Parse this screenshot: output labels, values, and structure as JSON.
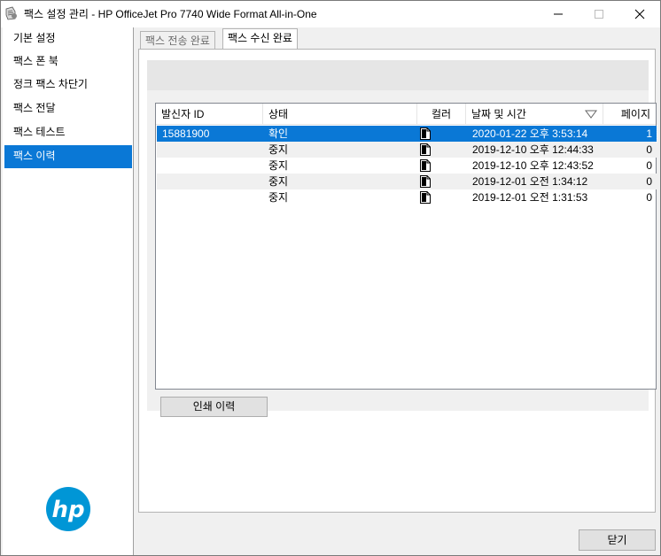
{
  "window": {
    "title": "팩스 설정 관리 - HP OfficeJet Pro 7740 Wide Format All-in-One"
  },
  "sidebar": {
    "items": [
      {
        "label": "기본 설정",
        "selected": false
      },
      {
        "label": "팩스 폰 북",
        "selected": false
      },
      {
        "label": "정크 팩스 차단기",
        "selected": false
      },
      {
        "label": "팩스 전달",
        "selected": false
      },
      {
        "label": "팩스 테스트",
        "selected": false
      },
      {
        "label": "팩스 이력",
        "selected": true
      }
    ],
    "logo": "hp-logo"
  },
  "tabs": [
    {
      "label": "팩스 전송 완료",
      "active": false
    },
    {
      "label": "팩스 수신 완료",
      "active": true
    }
  ],
  "table": {
    "columns": [
      "발신자 ID",
      "상태",
      "컬러",
      "날짜 및 시간",
      "페이지"
    ],
    "sorted_column": "날짜 및 시간",
    "rows": [
      {
        "sender": "15881900",
        "status": "확인",
        "color_icon": "document-icon",
        "datetime": "2020-01-22 오후 3:53:14",
        "pages": "1",
        "selected": true
      },
      {
        "sender": "",
        "status": "중지",
        "color_icon": "document-icon",
        "datetime": "2019-12-10 오후 12:44:33",
        "pages": "0",
        "selected": false
      },
      {
        "sender": "",
        "status": "중지",
        "color_icon": "document-icon",
        "datetime": "2019-12-10 오후 12:43:52",
        "pages": "0",
        "selected": false
      },
      {
        "sender": "",
        "status": "중지",
        "color_icon": "document-icon",
        "datetime": "2019-12-01 오전 1:34:12",
        "pages": "0",
        "selected": false
      },
      {
        "sender": "",
        "status": "중지",
        "color_icon": "document-icon",
        "datetime": "2019-12-01 오전 1:31:53",
        "pages": "0",
        "selected": false
      }
    ]
  },
  "buttons": {
    "print_history": "인쇄 이력",
    "close": "닫기"
  },
  "colors": {
    "accent": "#0a78d6",
    "hp_blue": "#0096d6"
  }
}
